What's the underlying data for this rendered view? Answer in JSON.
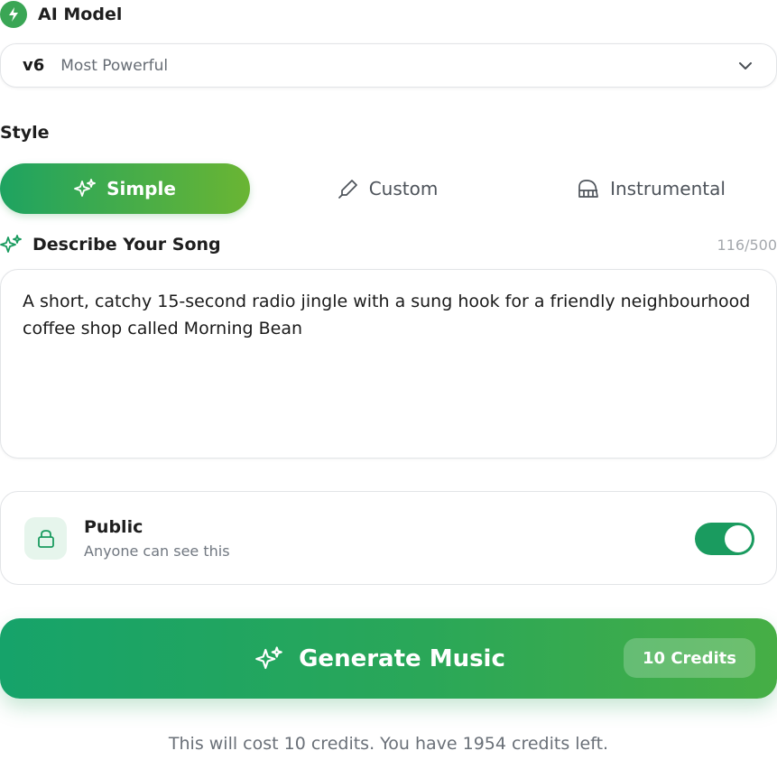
{
  "model": {
    "title": "AI Model",
    "selected_version": "v6",
    "selected_description": "Most Powerful"
  },
  "style": {
    "label": "Style",
    "tabs": [
      {
        "label": "Simple",
        "icon": "sparkles-icon",
        "active": true
      },
      {
        "label": "Custom",
        "icon": "pen-icon",
        "active": false
      },
      {
        "label": "Instrumental",
        "icon": "piano-icon",
        "active": false
      }
    ]
  },
  "describe": {
    "title": "Describe Your Song",
    "counter": "116/500",
    "text": "A short, catchy 15-second radio jingle with a sung hook for a friendly neighbourhood coffee shop called Morning Bean"
  },
  "visibility": {
    "title": "Public",
    "subtitle": "Anyone can see this",
    "enabled": true
  },
  "generate": {
    "label": "Generate Music",
    "credits_badge": "10 Credits"
  },
  "cost_note": "This will cost 10 credits. You have 1954 credits left.",
  "colors": {
    "accent": "#1a9b5f",
    "gradient_start": "#1ea361",
    "gradient_end": "#6ab533"
  }
}
